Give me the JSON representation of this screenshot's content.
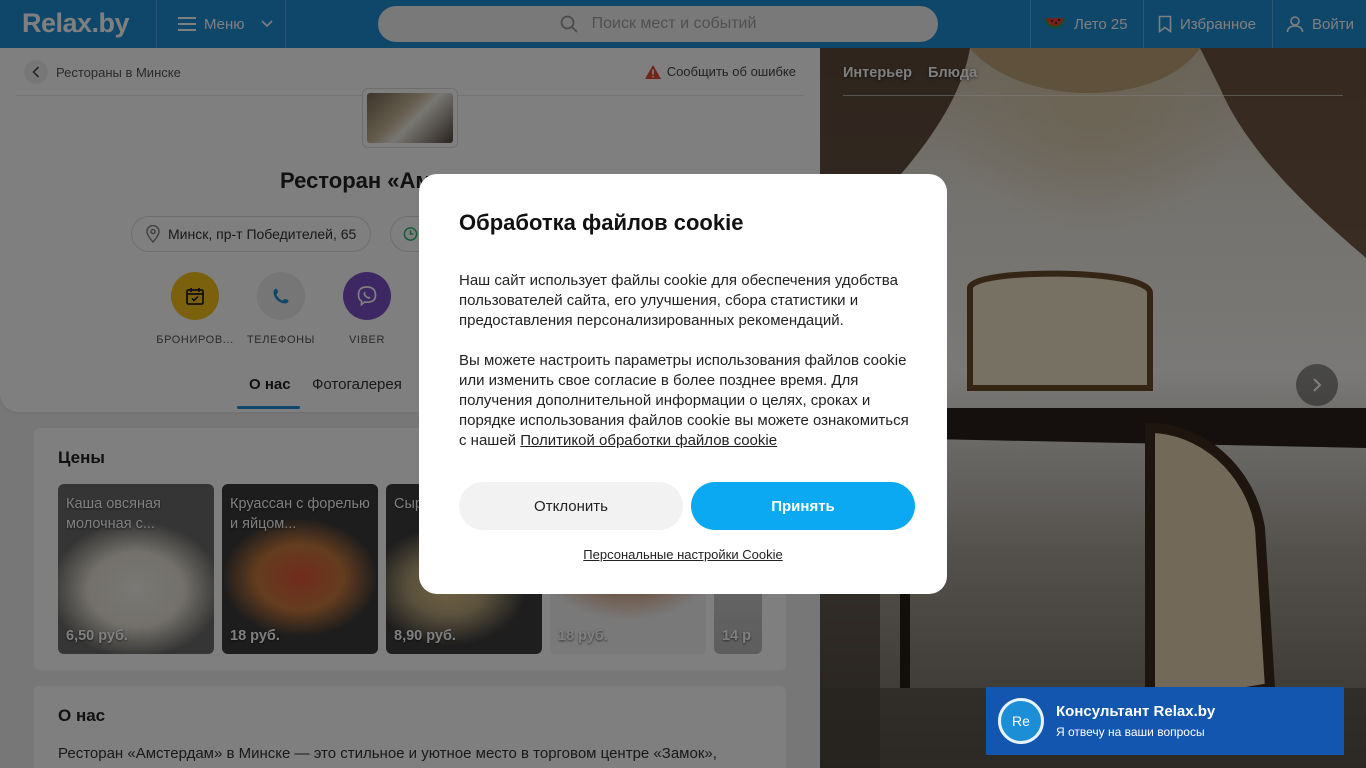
{
  "header": {
    "logo": "Relax.by",
    "menu_label": "Меню",
    "search_placeholder": "Поиск мест и событий",
    "summer_label": "Лето 25",
    "favorites_label": "Избранное",
    "login_label": "Войти"
  },
  "page": {
    "breadcrumb": "Рестораны в Минске",
    "report_error": "Сообщить об ошибке",
    "title": "Ресторан «Ам",
    "address": "Минск, пр-т Победителей, 65",
    "actions": [
      {
        "label": "БРОНИРОВ...",
        "icon": "calendar-icon"
      },
      {
        "label": "ТЕЛЕФОНЫ",
        "icon": "phone-icon"
      },
      {
        "label": "VIBER",
        "icon": "viber-icon"
      }
    ],
    "tabs": [
      {
        "label": "О нас",
        "active": true
      },
      {
        "label": "Фотогалерея",
        "active": false
      }
    ]
  },
  "prices": {
    "heading": "Цены",
    "items": [
      {
        "name": "Каша овсяная молочная с...",
        "price": "6,50 руб."
      },
      {
        "name": "Круассан с форелью и яйцом...",
        "price": "18 руб."
      },
      {
        "name": "Сыр сме",
        "price": "8,90 руб."
      },
      {
        "name": "",
        "price": "18 руб."
      },
      {
        "name": "",
        "price": "14 р"
      }
    ]
  },
  "about": {
    "heading": "О нас",
    "text": "Ресторан «Амстердам» в Минске — это стильное и уютное место в торговом центре «Замок»,"
  },
  "gallery": {
    "tabs": [
      "Интерьер",
      "Блюда"
    ]
  },
  "cookie": {
    "title": "Обработка файлов cookie",
    "paragraph1": "Наш сайт использует файлы cookie для обеспечения удобства пользователей сайта, его улучшения, сбора статистики и предоставления персонализированных рекомендаций.",
    "paragraph2": "Вы можете настроить параметры использования файлов cookie или изменить свое согласие в более позднее время. Для получения дополнительной информации о целях, сроках и порядке использования файлов cookie вы можете ознакомиться с нашей",
    "policy_link": "Политикой обработки файлов cookie",
    "decline_label": "Отклонить",
    "accept_label": "Принять",
    "settings_link": "Персональные настройки Cookie"
  },
  "consultant": {
    "avatar_text": "Re",
    "title": "Консультант Relax.by",
    "subtitle": "Я отвечу на ваши вопросы"
  },
  "colors": {
    "header_bg": "#1f8fd6",
    "accept_bg": "#0aa9f2",
    "consultant_bg": "#1256b0",
    "booking_yellow": "#f7c21a",
    "viber_purple": "#7a51c6"
  }
}
